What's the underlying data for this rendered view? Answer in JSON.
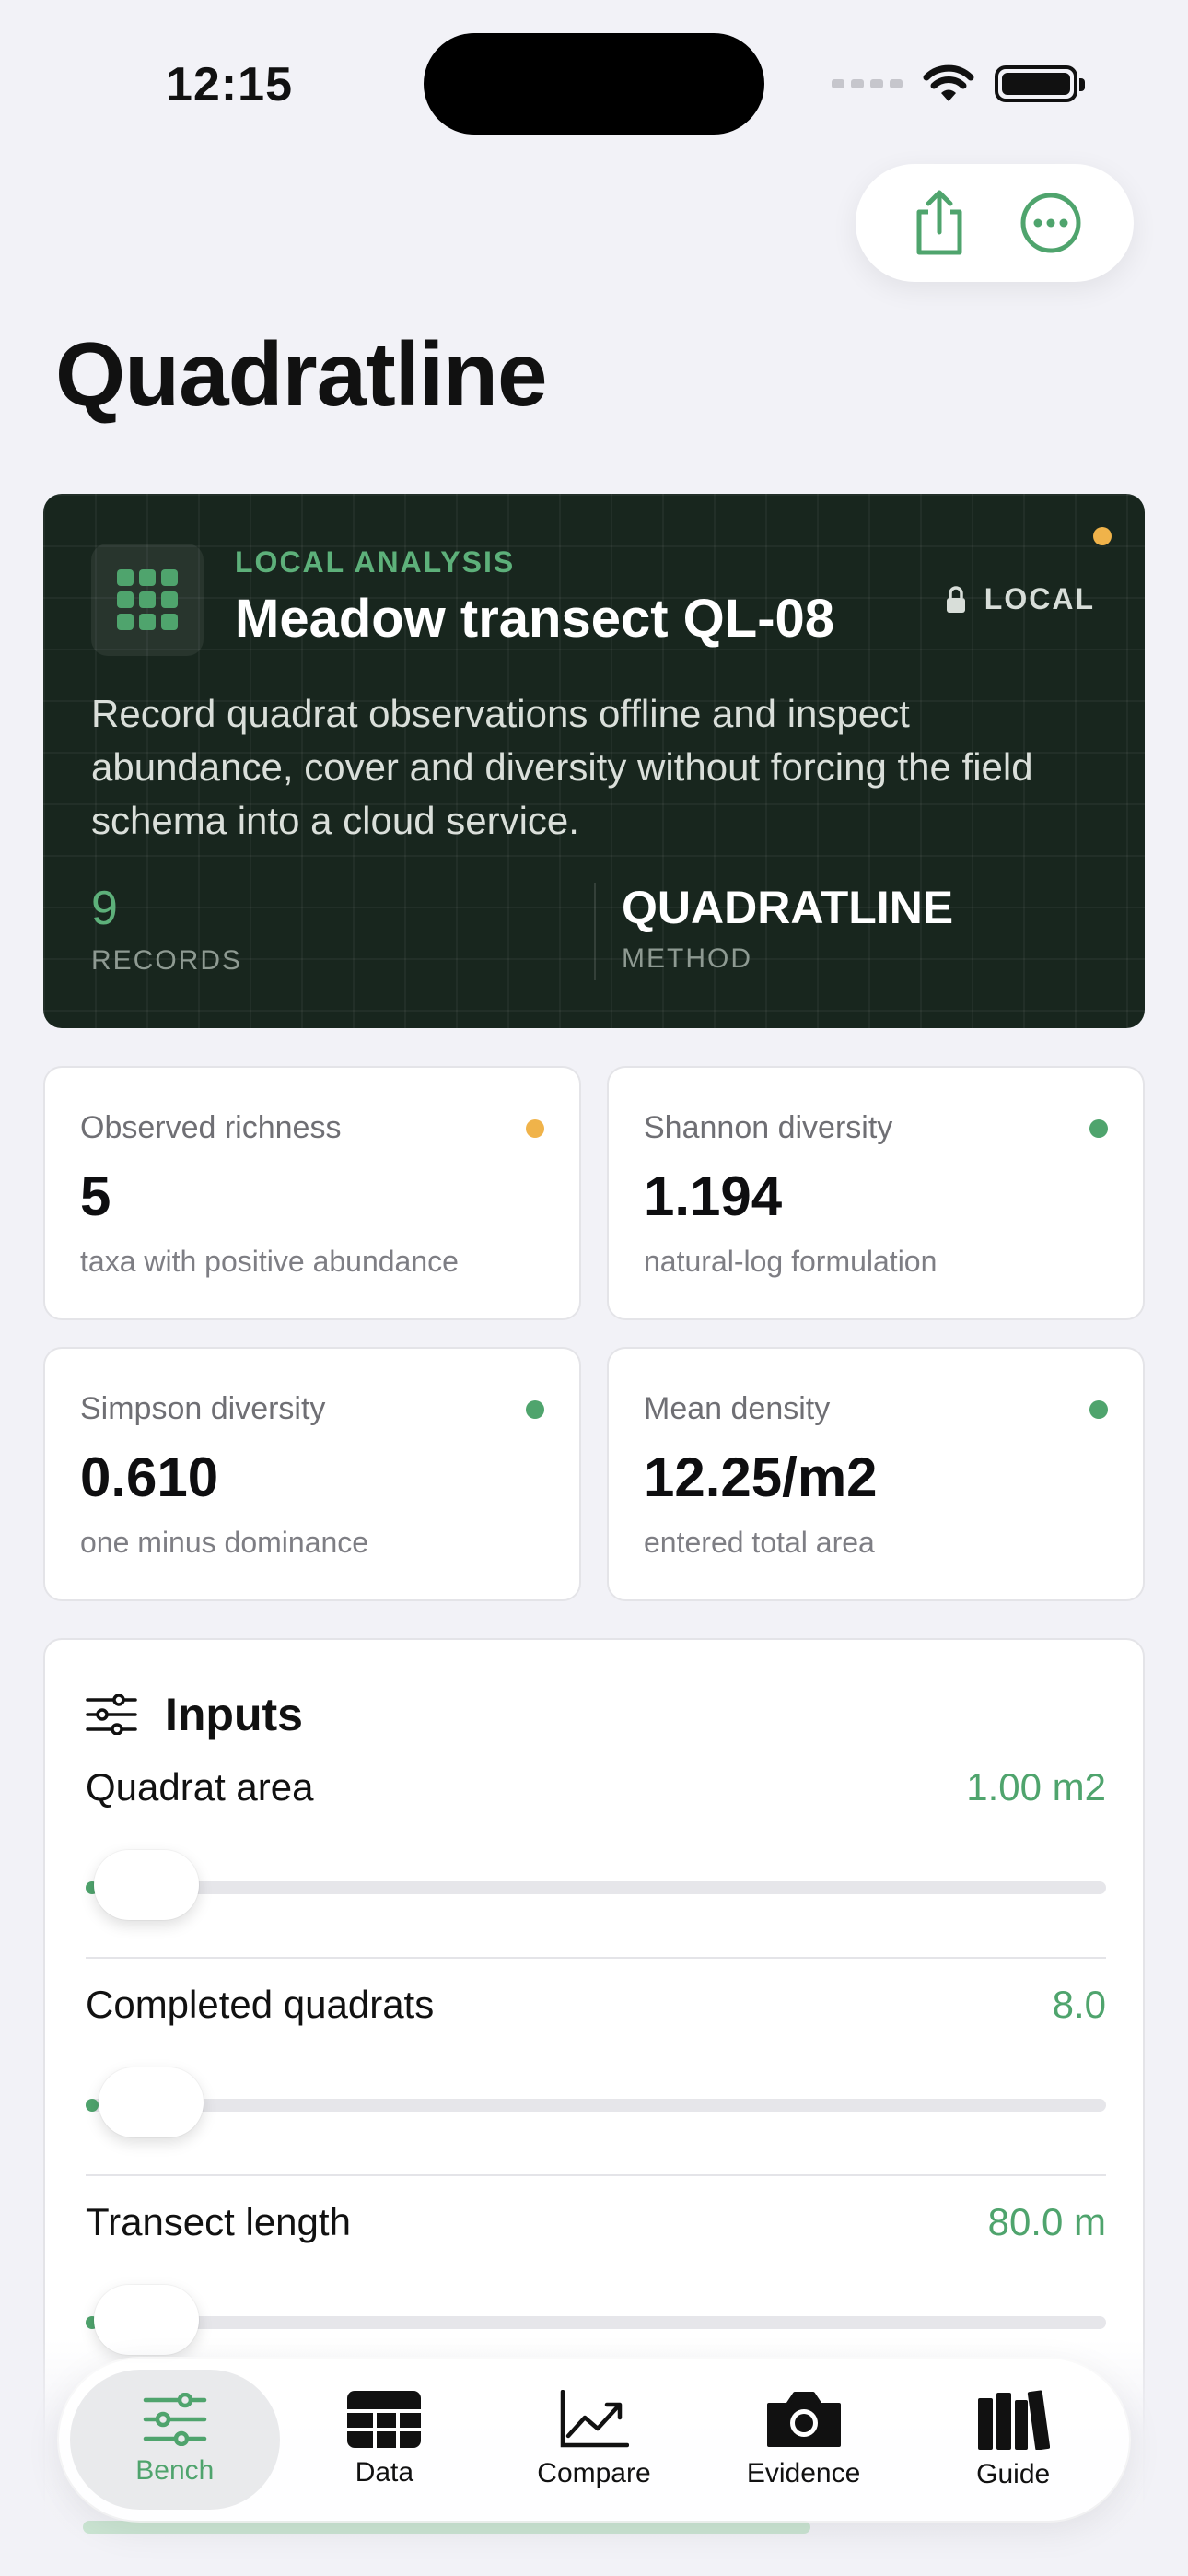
{
  "status_bar": {
    "time": "12:15"
  },
  "header": {
    "title": "Quadratline"
  },
  "hero": {
    "kicker": "LOCAL ANALYSIS",
    "name": "Meadow transect QL-08",
    "badge": "LOCAL",
    "description": "Record quadrat observations offline and inspect abundance, cover and diversity without forcing the field schema into a cloud service.",
    "records_value": "9",
    "records_label": "RECORDS",
    "method_value": "QUADRATLINE",
    "method_label": "METHOD"
  },
  "metrics": [
    {
      "label": "Observed richness",
      "value": "5",
      "sub": "taxa with positive abundance",
      "status": "amber"
    },
    {
      "label": "Shannon diversity",
      "value": "1.194",
      "sub": "natural-log formulation",
      "status": "green"
    },
    {
      "label": "Simpson diversity",
      "value": "0.610",
      "sub": "one minus dominance",
      "status": "green"
    },
    {
      "label": "Mean density",
      "value": "12.25/m2",
      "sub": "entered total area",
      "status": "green"
    }
  ],
  "inputs": {
    "title": "Inputs",
    "rows": [
      {
        "label": "Quadrat area",
        "value": "1.00 m2",
        "slider_fraction": 0.005
      },
      {
        "label": "Completed quadrats",
        "value": "8.0",
        "slider_fraction": 0.01
      },
      {
        "label": "Transect length",
        "value": "80.0 m",
        "slider_fraction": 0.005
      }
    ]
  },
  "tabs": [
    {
      "label": "Bench",
      "icon": "sliders-icon",
      "active": true
    },
    {
      "label": "Data",
      "icon": "table-icon",
      "active": false
    },
    {
      "label": "Compare",
      "icon": "trend-chart-icon",
      "active": false
    },
    {
      "label": "Evidence",
      "icon": "camera-icon",
      "active": false
    },
    {
      "label": "Guide",
      "icon": "books-icon",
      "active": false
    }
  ],
  "colors": {
    "accent": "#4FA46D",
    "amber": "#F0B34A",
    "hero_bg": "#18261E",
    "page_bg": "#F2F2F7"
  }
}
